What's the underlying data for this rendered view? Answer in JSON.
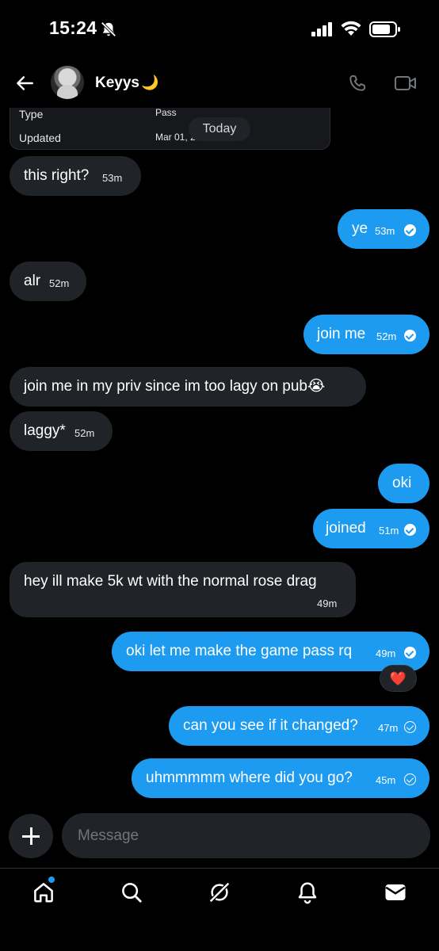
{
  "status": {
    "time": "15:24"
  },
  "header": {
    "name": "Keyys",
    "name_emoji": "🌙"
  },
  "card": {
    "rows": [
      {
        "label": "Type",
        "value": "Pass"
      },
      {
        "label": "Updated",
        "value": "Mar 01, 2"
      }
    ]
  },
  "date_divider": "Today",
  "messages": [
    {
      "dir": "in",
      "text": "this right?",
      "time": "53m"
    },
    {
      "dir": "out",
      "text": "ye",
      "time": "53m",
      "status": "read"
    },
    {
      "dir": "in",
      "text": "alr",
      "time": "52m"
    },
    {
      "dir": "out",
      "text": "join me",
      "time": "52m",
      "status": "read"
    },
    {
      "dir": "in",
      "text": "join me in my priv since im too lagy on pub😭",
      "time": ""
    },
    {
      "dir": "in",
      "text": "laggy*",
      "time": "52m"
    },
    {
      "dir": "out",
      "text": "oki",
      "time": ""
    },
    {
      "dir": "out",
      "text": "joined",
      "time": "51m",
      "status": "read"
    },
    {
      "dir": "in",
      "text": "hey ill make 5k wt with the normal rose drag",
      "time": "49m"
    },
    {
      "dir": "out",
      "text": "oki let me make the game pass rq",
      "time": "49m",
      "status": "read",
      "reaction": "❤️"
    },
    {
      "dir": "out",
      "text": "can you see if it changed?",
      "time": "47m",
      "status": "sent"
    },
    {
      "dir": "out",
      "text": "uhmmmmm where did you go?",
      "time": "45m",
      "status": "sent"
    }
  ],
  "composer": {
    "placeholder": "Message"
  },
  "colors": {
    "accent": "#1d9bf0",
    "incoming_bubble": "#202327",
    "background": "#000000"
  }
}
